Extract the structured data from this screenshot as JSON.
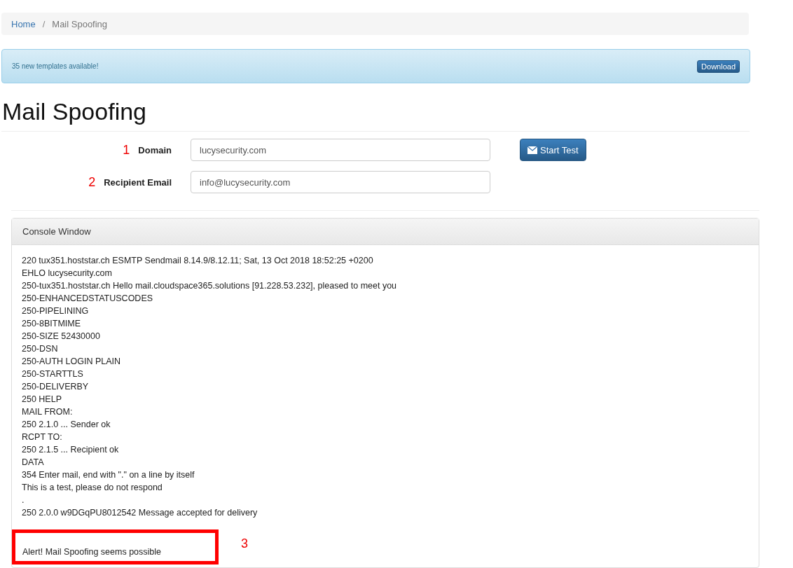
{
  "breadcrumb": [
    {
      "label": "Home",
      "kind": "link"
    },
    {
      "label": "/",
      "kind": "separator"
    },
    {
      "label": "Mail Spoofing",
      "kind": "current"
    }
  ],
  "notice": {
    "text": "35 new templates available!",
    "button": "Download"
  },
  "title": "Mail Spoofing",
  "form": {
    "fields": [
      {
        "marker": "1",
        "label": "Domain",
        "value": "lucysecurity.com"
      },
      {
        "marker": "2",
        "label": "Recipient Email",
        "value": "info@lucysecurity.com"
      }
    ],
    "button": "Start Test"
  },
  "console": {
    "title": "Console Window",
    "lines": [
      "220 tux351.hoststar.ch ESMTP Sendmail 8.14.9/8.12.11; Sat, 13 Oct 2018 18:52:25 +0200",
      "EHLO lucysecurity.com",
      "250-tux351.hoststar.ch Hello mail.cloudspace365.solutions [91.228.53.232], pleased to meet you",
      "250-ENHANCEDSTATUSCODES",
      "250-PIPELINING",
      "250-8BITMIME",
      "250-SIZE 52430000",
      "250-DSN",
      "250-AUTH LOGIN PLAIN",
      "250-STARTTLS",
      "250-DELIVERBY",
      "250 HELP",
      "MAIL FROM:",
      "250 2.1.0 ... Sender ok",
      "RCPT TO:",
      "250 2.1.5 ... Recipient ok",
      "DATA",
      "354 Enter mail, end with \".\" on a line by itself",
      "This is a test, please do not respond",
      ".",
      "250 2.0.0 w9DGqPU8012542 Message accepted for delivery"
    ],
    "alert": "Alert! Mail Spoofing seems possible",
    "alert_marker": "3"
  }
}
